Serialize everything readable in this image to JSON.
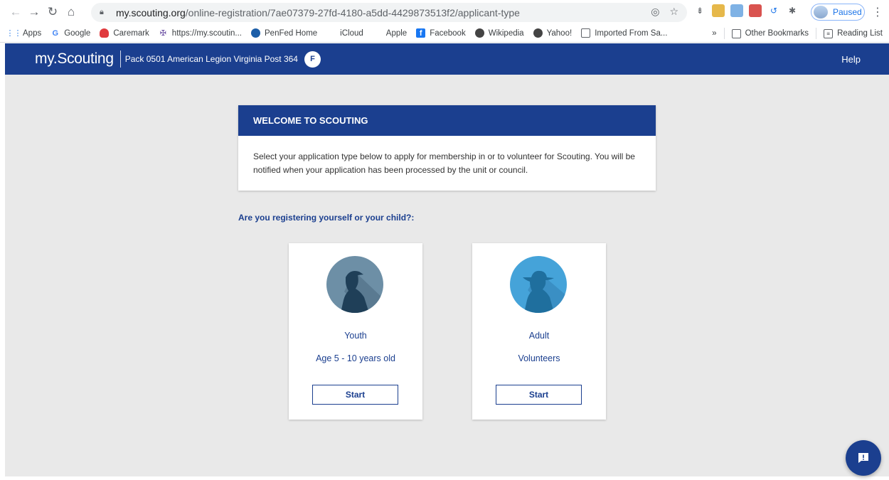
{
  "browser": {
    "url_host": "my.scouting.org",
    "url_path": "/online-registration/7ae07379-27fd-4180-a5dd-4429873513f2/applicant-type",
    "profile_status": "Paused"
  },
  "bookmarks": {
    "items": [
      {
        "label": "Apps",
        "icon": "apps-grid-icon"
      },
      {
        "label": "Google",
        "icon": "google-icon"
      },
      {
        "label": "Caremark",
        "icon": "caremark-icon"
      },
      {
        "label": "https://my.scoutin...",
        "icon": "scouting-icon"
      },
      {
        "label": "PenFed Home",
        "icon": "penfed-icon"
      },
      {
        "label": "iCloud",
        "icon": "apple-icon"
      },
      {
        "label": "Apple",
        "icon": "apple-icon"
      },
      {
        "label": "Facebook",
        "icon": "facebook-icon"
      },
      {
        "label": "Wikipedia",
        "icon": "globe-icon"
      },
      {
        "label": "Yahoo!",
        "icon": "globe-icon"
      },
      {
        "label": "Imported From Sa...",
        "icon": "folder-icon"
      }
    ],
    "overflow": "»",
    "other": "Other Bookmarks",
    "reading_list": "Reading List"
  },
  "header": {
    "brand": "my.Scouting",
    "unit": "Pack 0501 American Legion Virginia Post 364",
    "avatar_initial": "F",
    "help": "Help"
  },
  "welcome": {
    "title": "WELCOME TO SCOUTING",
    "body": "Select your application type below to apply for membership in or to volunteer for Scouting. You will be notified when your application has been processed by the unit or council."
  },
  "question": "Are you registering yourself or your child?:",
  "cards": [
    {
      "title": "Youth",
      "subtitle": "Age 5 - 10 years old",
      "button": "Start",
      "circle_color": "#6d8fa6",
      "figure_color": "#1f3f58"
    },
    {
      "title": "Adult",
      "subtitle": "Volunteers",
      "button": "Start",
      "circle_color": "#45a3d9",
      "figure_color": "#1f6f9e"
    }
  ],
  "colors": {
    "brand_blue": "#1b3f8f",
    "page_bg": "#e9e9e9"
  }
}
